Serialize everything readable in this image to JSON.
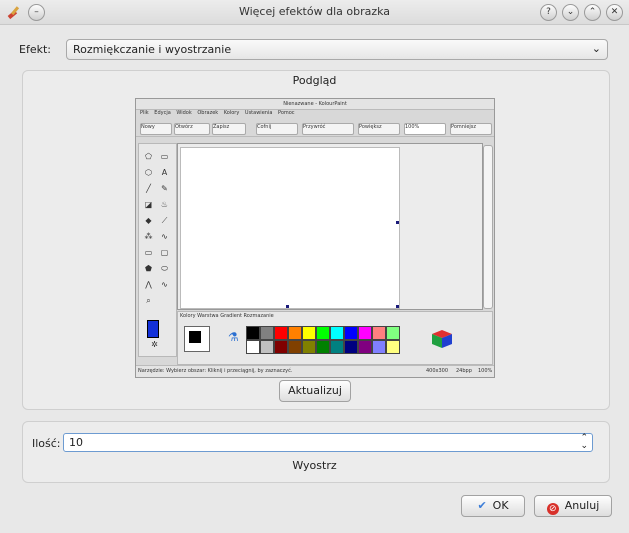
{
  "window": {
    "title": "Więcej efektów dla obrazka"
  },
  "effect": {
    "label": "Efekt:",
    "value": "Rozmiękczanie i wyostrzanie"
  },
  "preview": {
    "title": "Podgląd",
    "update_button": "Aktualizuj",
    "mini_app": {
      "title": "Nienazwane - KolourPaint",
      "menu": [
        "Plik",
        "Edycja",
        "Widok",
        "Obrazek",
        "Kolory",
        "Ustawienia",
        "Pomoc"
      ],
      "toolbar": [
        "Nowy",
        "Otwórz",
        "Zapisz",
        "Cofnij",
        "Przywróć",
        "Powiększ",
        "100%",
        "Pomniejsz"
      ],
      "colors_label": "Kolory  Warstwa  Gradient  Rozmazanie",
      "status": "Narzędzie: Wybierz obszar: Kliknij i przeciągnij, by zaznaczyć.",
      "status_right": [
        "400x300",
        "24bpp",
        "100%"
      ],
      "palette_top": [
        "#000000",
        "#808080",
        "#ff0000",
        "#ff8000",
        "#ffff00",
        "#00ff00",
        "#00ffff",
        "#0000ff",
        "#ff00ff",
        "#ff8080",
        "#80ff80"
      ],
      "palette_bottom": [
        "#ffffff",
        "#c0c0c0",
        "#800000",
        "#804000",
        "#808000",
        "#008000",
        "#008080",
        "#000080",
        "#800080",
        "#8080ff",
        "#ffff80"
      ]
    }
  },
  "amount": {
    "label": "Ilość:",
    "value": "10",
    "caption": "Wyostrz"
  },
  "buttons": {
    "ok": "OK",
    "cancel": "Anuluj"
  }
}
